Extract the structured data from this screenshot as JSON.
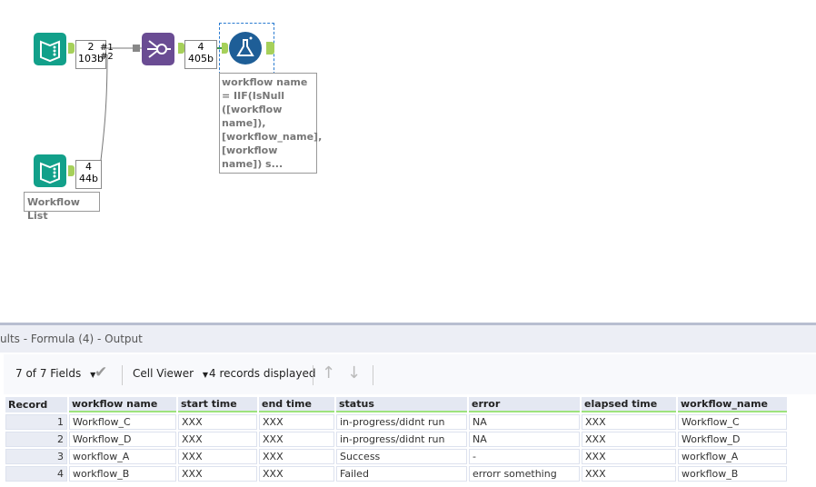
{
  "canvas": {
    "counts": [
      {
        "records": "2",
        "bytes": "103b",
        "labels": "#1 #2"
      },
      {
        "records": "4",
        "bytes": "405b"
      },
      {
        "records": "4",
        "bytes": "44b"
      }
    ],
    "annotation": "workflow name = IIF(IsNull ([workflow name]), [workflow_name], [workflow name]) s...",
    "input_label": "Workflow List",
    "colors": {
      "input": "#12a08a",
      "union": "#6a4c93",
      "formula": "#1e5e97",
      "anchor": "#a6d05a"
    }
  },
  "results": {
    "title": "ults - Formula (4) - Output",
    "fields_label": "7 of 7 Fields",
    "cell_viewer": "Cell Viewer",
    "records_displayed": "4 records displayed",
    "columns": [
      "Record",
      "workflow name",
      "start time",
      "end time",
      "status",
      "error",
      "elapsed time",
      "workflow_name"
    ],
    "rows": [
      [
        "1",
        "Workflow_C",
        "XXX",
        "XXX",
        "in-progress/didnt run",
        "NA",
        "XXX",
        "Workflow_C"
      ],
      [
        "2",
        "Workflow_D",
        "XXX",
        "XXX",
        "in-progress/didnt run",
        "NA",
        "XXX",
        "Workflow_D"
      ],
      [
        "3",
        "workflow_A",
        "XXX",
        "XXX",
        "Success",
        "-",
        "XXX",
        "workflow_A"
      ],
      [
        "4",
        "workflow_B",
        "XXX",
        "XXX",
        "Failed",
        "errorr something",
        "XXX",
        "workflow_B"
      ]
    ]
  }
}
